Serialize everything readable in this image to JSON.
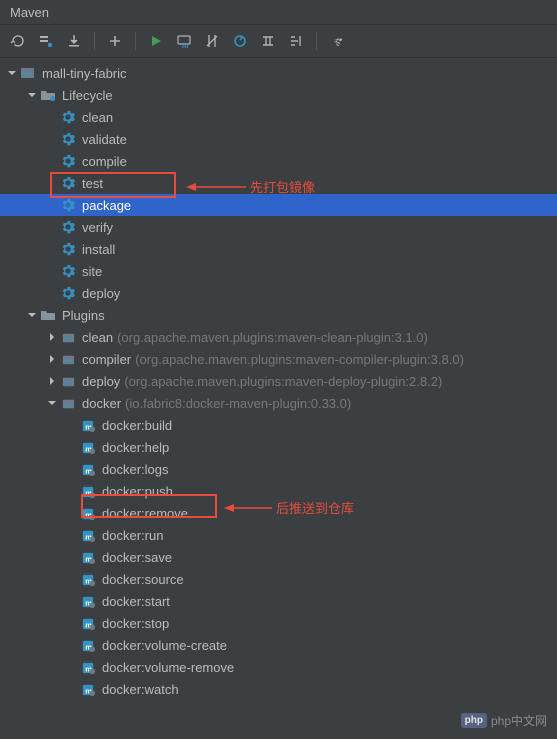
{
  "panel": {
    "title": "Maven"
  },
  "tree": {
    "root": {
      "label": "mall-tiny-fabric"
    },
    "lifecycle": {
      "label": "Lifecycle",
      "goals": [
        "clean",
        "validate",
        "compile",
        "test",
        "package",
        "verify",
        "install",
        "site",
        "deploy"
      ],
      "selected_index": 4
    },
    "plugins": {
      "label": "Plugins",
      "items": [
        {
          "name": "clean",
          "coords": "(org.apache.maven.plugins:maven-clean-plugin:3.1.0)",
          "expanded": false
        },
        {
          "name": "compiler",
          "coords": "(org.apache.maven.plugins:maven-compiler-plugin:3.8.0)",
          "expanded": false
        },
        {
          "name": "deploy",
          "coords": "(org.apache.maven.plugins:maven-deploy-plugin:2.8.2)",
          "expanded": false
        },
        {
          "name": "docker",
          "coords": "(io.fabric8:docker-maven-plugin:0.33.0)",
          "expanded": true
        }
      ],
      "docker_goals": [
        "docker:build",
        "docker:help",
        "docker:logs",
        "docker:push",
        "docker:remove",
        "docker:run",
        "docker:save",
        "docker:source",
        "docker:start",
        "docker:stop",
        "docker:volume-create",
        "docker:volume-remove",
        "docker:watch"
      ]
    }
  },
  "annotations": {
    "package_note": "先打包镜像",
    "push_note": "后推送到仓库"
  },
  "watermark": {
    "text": "php中文网",
    "logo": "php"
  }
}
